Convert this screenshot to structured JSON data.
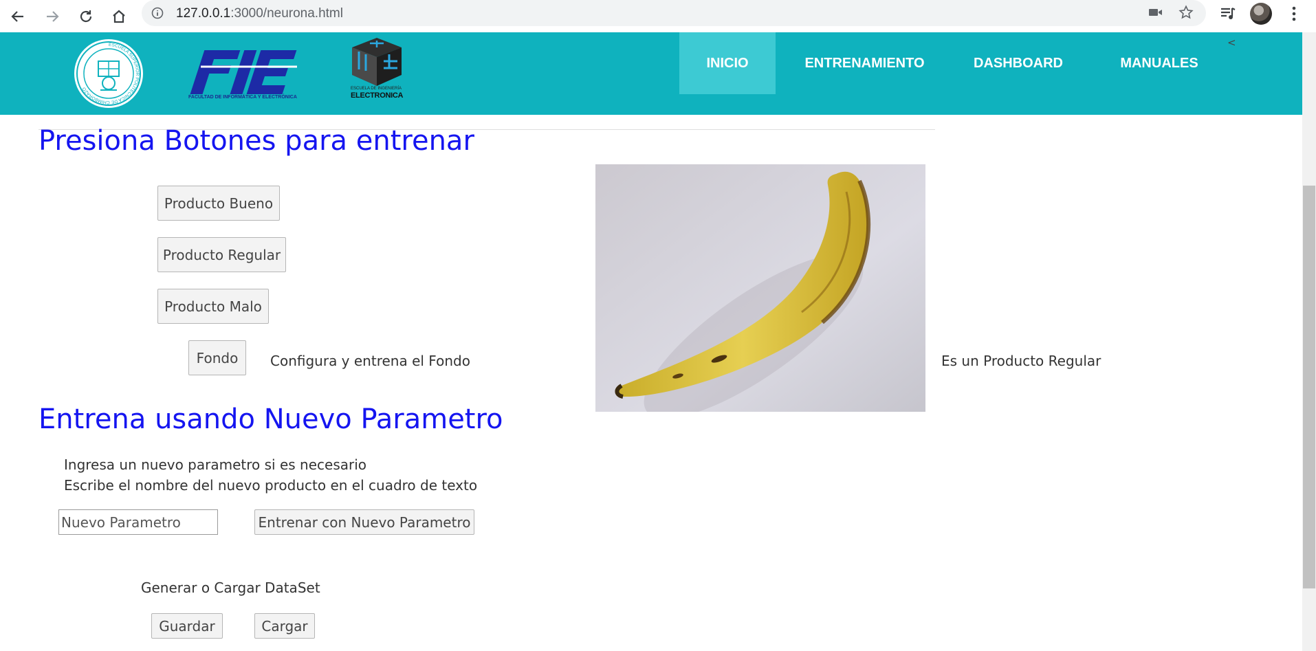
{
  "browser": {
    "url_host": "127.0.0.1",
    "url_rest": ":3000/neurona.html",
    "icons": [
      "back-arrow-icon",
      "forward-arrow-icon",
      "reload-icon",
      "home-icon",
      "info-icon",
      "camera-icon",
      "star-icon",
      "media-queue-icon",
      "profile-avatar",
      "menu-dots-icon"
    ]
  },
  "header": {
    "logo_fie": "FIE",
    "logo_fie_caption": "FACULTAD DE INFORMÁTICA Y ELECTRÓNICA",
    "logo_elec_top": "ESCUELA DE INGENIERÍA",
    "logo_elec_main": "ELECTRONICA",
    "menu": [
      {
        "label": "INICIO",
        "active": true
      },
      {
        "label": "ENTRENAMIENTO",
        "active": false
      },
      {
        "label": "DASHBOARD",
        "active": false
      },
      {
        "label": "MANUALES",
        "active": false
      }
    ],
    "collapse_glyph": "<"
  },
  "training": {
    "heading": "Presiona Botones para entrenar",
    "btn_bueno": "Producto Bueno",
    "btn_regular": "Producto Regular",
    "btn_malo": "Producto Malo",
    "btn_fondo": "Fondo",
    "fondo_note": "Configura y entrena el Fondo",
    "result": "Es un Producto Regular"
  },
  "new_param": {
    "heading": "Entrena usando Nuevo Parametro",
    "line1": "Ingresa un nuevo parametro si es necesario",
    "line2": "Escribe el nombre del nuevo producto en el cuadro de texto",
    "input_placeholder": "Nuevo Parametro",
    "train_button": "Entrenar con Nuevo Parametro"
  },
  "dataset": {
    "label": "Generar o Cargar DataSet",
    "save": "Guardar",
    "load": "Cargar"
  },
  "colors": {
    "header_bg": "#0fb2be",
    "menu_active_bg": "#3dcad3",
    "heading_blue": "#1515f0"
  }
}
